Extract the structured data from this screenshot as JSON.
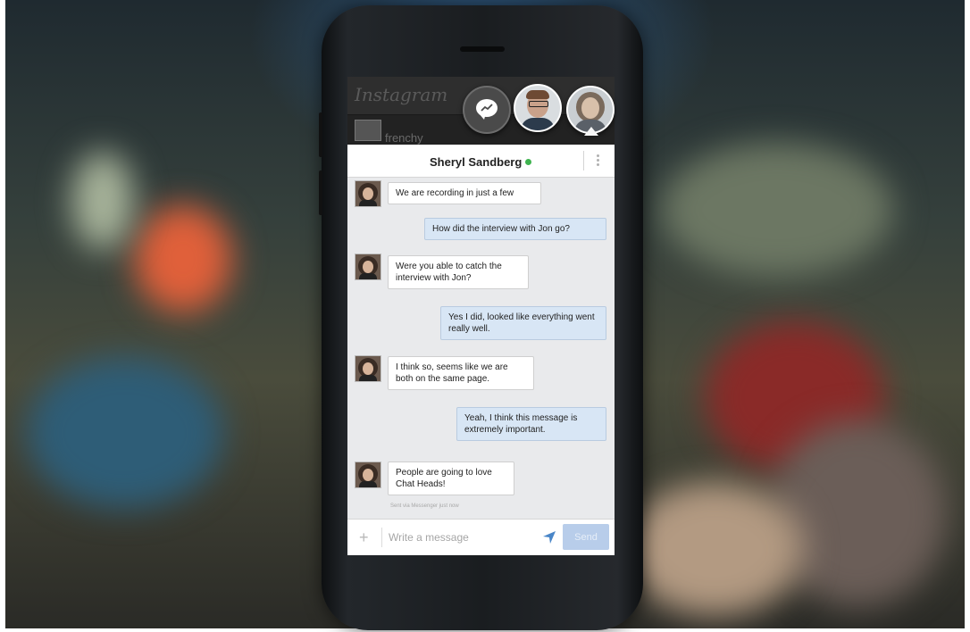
{
  "background_app": {
    "title": "Instagram",
    "feed_user": "frenchy"
  },
  "chat_heads": [
    {
      "name": "messenger-chat-head",
      "icon": "messenger-bolt-icon"
    },
    {
      "name": "chat-head-man"
    },
    {
      "name": "chat-head-woman"
    }
  ],
  "conversation": {
    "contact_name": "Sheryl Sandberg",
    "online": true,
    "messages": [
      {
        "dir": "in",
        "text": "We are recording in just a few"
      },
      {
        "dir": "out",
        "text": "How did the interview with Jon go?"
      },
      {
        "dir": "in",
        "text": "Were you able to catch the interview with Jon?"
      },
      {
        "dir": "out",
        "text": "Yes I did, looked like everything went really well."
      },
      {
        "dir": "in",
        "text": "I think so, seems like we are both on the same page."
      },
      {
        "dir": "out",
        "text": "Yeah, I think this message is extremely important."
      },
      {
        "dir": "in",
        "text": "People are going to love Chat Heads!"
      }
    ],
    "status_line": "Sent via Messenger just now"
  },
  "composer": {
    "placeholder": "Write a message",
    "send_label": "Send"
  },
  "colors": {
    "online": "#3fb34f",
    "outgoing_bubble": "#d8e6f5",
    "send_button": "#b8cdea"
  }
}
